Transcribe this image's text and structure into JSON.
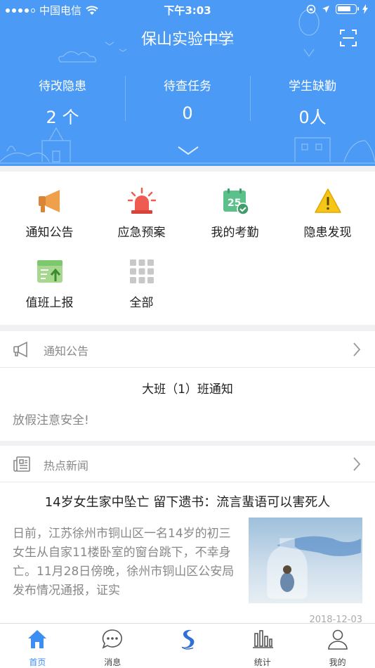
{
  "status_bar": {
    "carrier": "中国电信",
    "time": "下午3:03"
  },
  "header": {
    "title": "保山实验中学",
    "stats": [
      {
        "label": "待改隐患",
        "value": "2 个"
      },
      {
        "label": "待查任务",
        "value": "0"
      },
      {
        "label": "学生缺勤",
        "value": "0人"
      }
    ]
  },
  "menu": {
    "items": [
      {
        "label": "通知公告",
        "icon": "megaphone-icon",
        "color": "#f0a04b"
      },
      {
        "label": "应急预案",
        "icon": "siren-icon",
        "color": "#ef5b50"
      },
      {
        "label": "我的考勤",
        "icon": "calendar-check-icon",
        "color": "#5cc08a"
      },
      {
        "label": "隐患发现",
        "icon": "warning-icon",
        "color": "#f5c518"
      },
      {
        "label": "值班上报",
        "icon": "duty-report-icon",
        "color": "#7dc86f"
      },
      {
        "label": "全部",
        "icon": "grid-icon",
        "color": "#c8c8c8"
      }
    ]
  },
  "notice": {
    "header": "通知公告",
    "title": "大班（1）班通知",
    "content": "放假注意安全!"
  },
  "news": {
    "header": "热点新闻",
    "title": "14岁女生家中坠亡 留下遗书：流言蜚语可以害死人",
    "summary": "日前，江苏徐州市铜山区一名14岁的初三女生从自家11楼卧室的窗台跳下，不幸身亡。11月28日傍晚，徐州市铜山区公安局发布情况通报，证实",
    "date": "2018-12-03"
  },
  "tabbar": {
    "items": [
      {
        "label": "首页",
        "icon": "home-icon"
      },
      {
        "label": "消息",
        "icon": "message-icon"
      },
      {
        "label": "",
        "icon": "app-logo-icon"
      },
      {
        "label": "统计",
        "icon": "bar-chart-icon"
      },
      {
        "label": "我的",
        "icon": "person-icon"
      }
    ],
    "active_color": "#3c8ef3"
  },
  "colors": {
    "header_bg": "#4b9af5",
    "accent": "#3c8ef3"
  }
}
